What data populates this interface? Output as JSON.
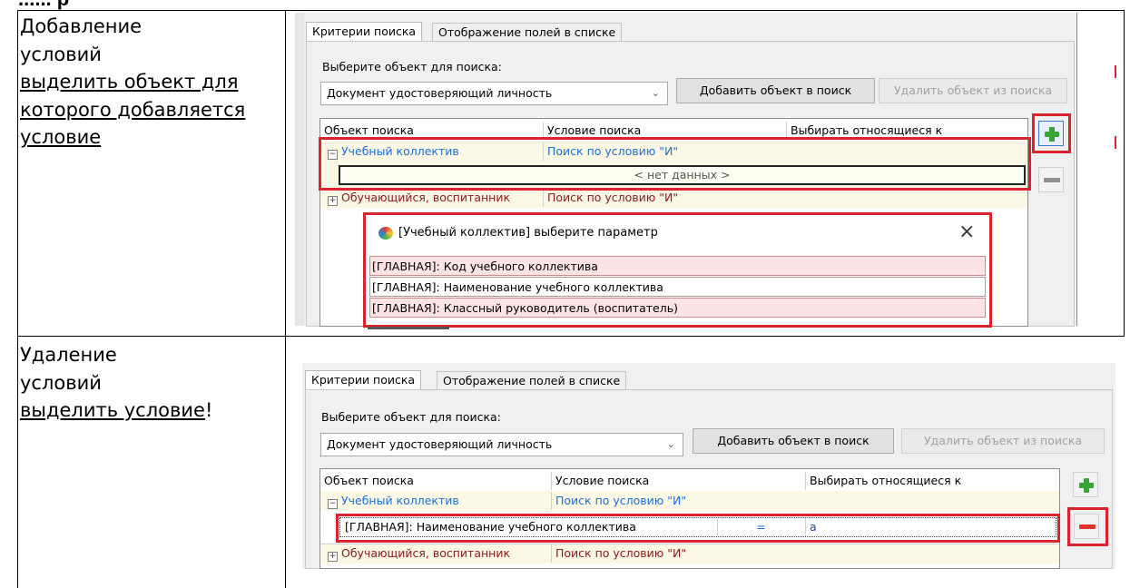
{
  "page_header_fragment": "...... р",
  "rows": [
    {
      "description": {
        "line1": "Добавление",
        "line2": "условий",
        "line3": "выделить объект для",
        "line4": "которого добавляется",
        "line5": "условие"
      },
      "ui": {
        "tabs": [
          "Критерии поиска",
          "Отображение полей в списке"
        ],
        "select_label": "Выберите объект для поиска:",
        "select_value": "Документ удостоверяющий личность",
        "add_button": "Добавить объект в поиск",
        "remove_button": "Удалить объект из поиска",
        "columns": [
          "Объект поиска",
          "Условие поиска",
          "Выбирать относящиеся к"
        ],
        "group1": {
          "name": "Учебный коллектив",
          "condition": "Поиск по условию \"И\""
        },
        "no_data": "< нет данных >",
        "group2": {
          "name": "Обучающийся, воспитанник",
          "condition": "Поиск по условию \"И\""
        },
        "popup": {
          "title": "[Учебный коллектив]  выберите параметр",
          "items": [
            "[ГЛАВНАЯ]: Код учебного коллектива",
            "[ГЛАВНАЯ]: Наименование учебного коллектива",
            "[ГЛАВНАЯ]: Классный руководитель (воспитатель)"
          ],
          "close": "×"
        }
      }
    },
    {
      "description": {
        "line1": "Удаление",
        "line2": "условий",
        "line3": "выделить условие",
        "line3_suffix": "!"
      },
      "ui": {
        "tabs": [
          "Критерии поиска",
          "Отображение полей в списке"
        ],
        "select_label": "Выберите объект для поиска:",
        "select_value": "Документ удостоверяющий личность",
        "add_button": "Добавить объект в поиск",
        "remove_button": "Удалить объект из поиска",
        "columns": [
          "Объект поиска",
          "Условие поиска",
          "Выбирать относящиеся к"
        ],
        "group1": {
          "name": "Учебный коллектив",
          "condition": "Поиск по условию \"И\""
        },
        "condition_row": {
          "field": "[ГЛАВНАЯ]: Наименование учебного коллектива",
          "operator": "=",
          "value": "а"
        },
        "group2": {
          "name": "Обучающийся, воспитанник",
          "condition": "Поиск по условию \"И\""
        }
      }
    }
  ],
  "icons": [
    "plus-icon",
    "minus-icon",
    "close-icon",
    "chevron-down-icon",
    "expand-icon",
    "collapse-icon",
    "palette-icon"
  ],
  "colors": {
    "highlight": "#d9232d",
    "link_blue": "#1d6fd8",
    "group_red": "#8b1a1a",
    "plus_green": "#3aa335"
  }
}
